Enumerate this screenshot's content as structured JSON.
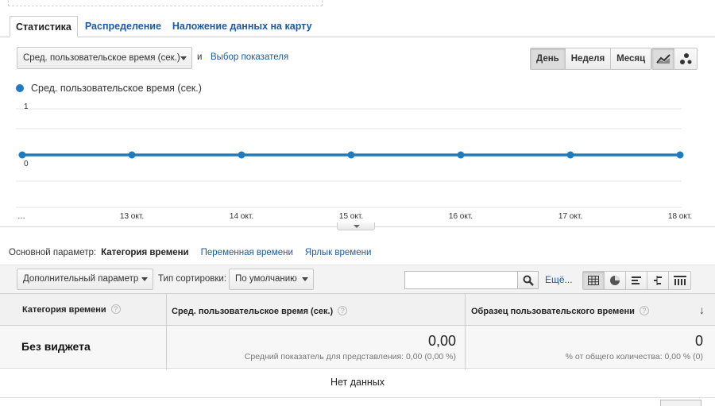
{
  "tabs": [
    "Статистика",
    "Распределение",
    "Наложение данных на карту"
  ],
  "metric_select": "Сред. пользовательское время (сек.)",
  "and_text": "и",
  "select_metric_link": "Выбор показателя",
  "period_buttons": [
    "День",
    "Неделя",
    "Месяц"
  ],
  "active_period": "День",
  "chart_type_icons": [
    "line-chart-icon",
    "motion-chart-icon"
  ],
  "colors": {
    "series": "#1f7bbf",
    "link": "#1a5aa6"
  },
  "chart_data": {
    "type": "line",
    "series": [
      {
        "name": "Сред. пользовательское время (сек.)",
        "values": [
          0,
          0,
          0,
          0,
          0,
          0,
          0
        ]
      }
    ],
    "x": [
      "…",
      "13 окт.",
      "14 окт.",
      "15 окт.",
      "16 окт.",
      "17 окт.",
      "18 окт."
    ],
    "ylim": [
      0,
      1
    ],
    "yticks": [
      "1",
      "0"
    ],
    "grid": true
  },
  "dimensions": {
    "label": "Основной параметр:",
    "current": "Категория времени",
    "options": [
      "Переменная времени",
      "Ярлык времени"
    ]
  },
  "toolbar": {
    "secondary_dimension": "Дополнительный параметр",
    "sort_label": "Тип сортировки:",
    "sort_value": "По умолчанию",
    "more_link": "Ещё...",
    "view_icons": [
      "table-view-icon",
      "pie-view-icon",
      "performance-view-icon",
      "comparison-view-icon",
      "pivot-view-icon"
    ]
  },
  "table": {
    "headers": [
      "Категория времени",
      "Сред. пользовательское время (сек.)",
      "Образец пользовательского времени"
    ],
    "help_glyph": "?",
    "sort_arrow": "↓",
    "row": {
      "title": "Без виджета",
      "avg_value": "0,00",
      "avg_sub": "Средний показатель для представления: 0,00 (0,00 %)",
      "sample_value": "0",
      "sample_sub": "% от общего количества: 0,00 % (0)"
    },
    "no_data": "Нет данных"
  }
}
